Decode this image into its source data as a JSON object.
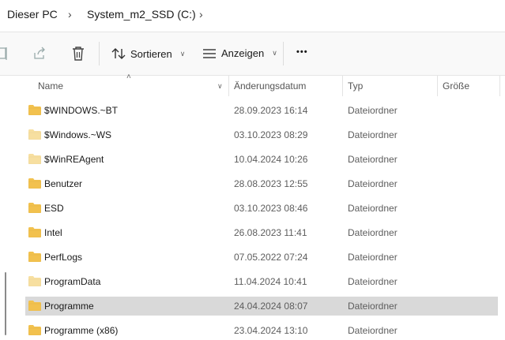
{
  "breadcrumb": {
    "items": [
      "Dieser PC",
      "System_m2_SSD (C:)"
    ]
  },
  "toolbar": {
    "sort_label": "Sortieren",
    "view_label": "Anzeigen",
    "more_label": "•••"
  },
  "columns": {
    "name": "Name",
    "date": "Änderungsdatum",
    "type": "Typ",
    "size": "Größe"
  },
  "rows": [
    {
      "name": "$WINDOWS.~BT",
      "date": "28.09.2023 16:14",
      "type": "Dateiordner",
      "hidden": false
    },
    {
      "name": "$Windows.~WS",
      "date": "03.10.2023 08:29",
      "type": "Dateiordner",
      "hidden": true
    },
    {
      "name": "$WinREAgent",
      "date": "10.04.2024 10:26",
      "type": "Dateiordner",
      "hidden": true
    },
    {
      "name": "Benutzer",
      "date": "28.08.2023 12:55",
      "type": "Dateiordner",
      "hidden": false
    },
    {
      "name": "ESD",
      "date": "03.10.2023 08:46",
      "type": "Dateiordner",
      "hidden": false
    },
    {
      "name": "Intel",
      "date": "26.08.2023 11:41",
      "type": "Dateiordner",
      "hidden": false
    },
    {
      "name": "PerfLogs",
      "date": "07.05.2022 07:24",
      "type": "Dateiordner",
      "hidden": false
    },
    {
      "name": "ProgramData",
      "date": "11.04.2024 10:41",
      "type": "Dateiordner",
      "hidden": true
    },
    {
      "name": "Programme",
      "date": "24.04.2024 08:07",
      "type": "Dateiordner",
      "hidden": false,
      "selected": true
    },
    {
      "name": "Programme (x86)",
      "date": "23.04.2024 13:10",
      "type": "Dateiordner",
      "hidden": false
    }
  ],
  "colors": {
    "folder": "#f2c14e",
    "folder_hidden": "#f7dfa0",
    "selected_row": "#d9d9d9"
  }
}
